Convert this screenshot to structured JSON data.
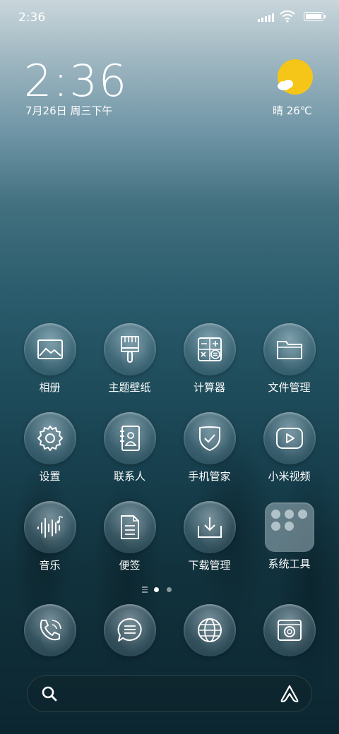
{
  "status_bar": {
    "time": "2:36"
  },
  "clock_widget": {
    "time": "2:36",
    "date": "7月26日 周三下午"
  },
  "weather_widget": {
    "text": "晴 26℃",
    "icon": "sunny-cloud-icon",
    "sun_color": "#f5c518"
  },
  "apps": [
    {
      "label": "相册",
      "icon": "gallery-icon"
    },
    {
      "label": "主题壁纸",
      "icon": "brush-icon"
    },
    {
      "label": "计算器",
      "icon": "calculator-icon"
    },
    {
      "label": "文件管理",
      "icon": "folder-icon"
    },
    {
      "label": "设置",
      "icon": "gear-icon"
    },
    {
      "label": "联系人",
      "icon": "contacts-icon"
    },
    {
      "label": "手机管家",
      "icon": "shield-check-icon"
    },
    {
      "label": "小米视频",
      "icon": "play-video-icon"
    },
    {
      "label": "音乐",
      "icon": "music-wave-icon"
    },
    {
      "label": "便签",
      "icon": "note-icon"
    },
    {
      "label": "下载管理",
      "icon": "download-icon"
    },
    {
      "label": "系统工具",
      "icon": "folder-grid-icon"
    }
  ],
  "page_indicator": {
    "pages": 2,
    "current": 1
  },
  "dock": [
    {
      "icon": "phone-icon"
    },
    {
      "icon": "message-icon"
    },
    {
      "icon": "browser-globe-icon"
    },
    {
      "icon": "camera-icon"
    }
  ],
  "search_bar": {
    "search_icon": "search-icon",
    "assistant_icon": "assistant-icon"
  }
}
